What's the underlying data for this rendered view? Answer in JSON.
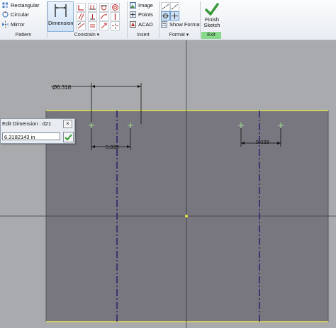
{
  "ribbon": {
    "pattern": {
      "items": [
        "Rectangular",
        "Circular",
        "Mirror"
      ],
      "label": "Pattern"
    },
    "constrain": {
      "dimension_label": "Dimension",
      "label": "Constrain ▾"
    },
    "insert": {
      "items": [
        "Image",
        "Points",
        "ACAD"
      ],
      "label": "Insert"
    },
    "format": {
      "show_format": "Show Format",
      "label": "Format ▾"
    },
    "exit": {
      "finish_line1": "Finish",
      "finish_line2": "Sketch",
      "label": "Exit"
    }
  },
  "dialog": {
    "title": "Edit Dimension : d21",
    "value": "6.3182143 in",
    "close": "×"
  },
  "sketch": {
    "dim_diameter": "Ø6.318",
    "dim_left": "5.039",
    "dim_right": "5.039"
  },
  "colors": {
    "sheet": "#78777f",
    "edge_highlight": "#e5e24a",
    "centerline": "#2e1f6b",
    "exit_bg": "#86d98a"
  }
}
